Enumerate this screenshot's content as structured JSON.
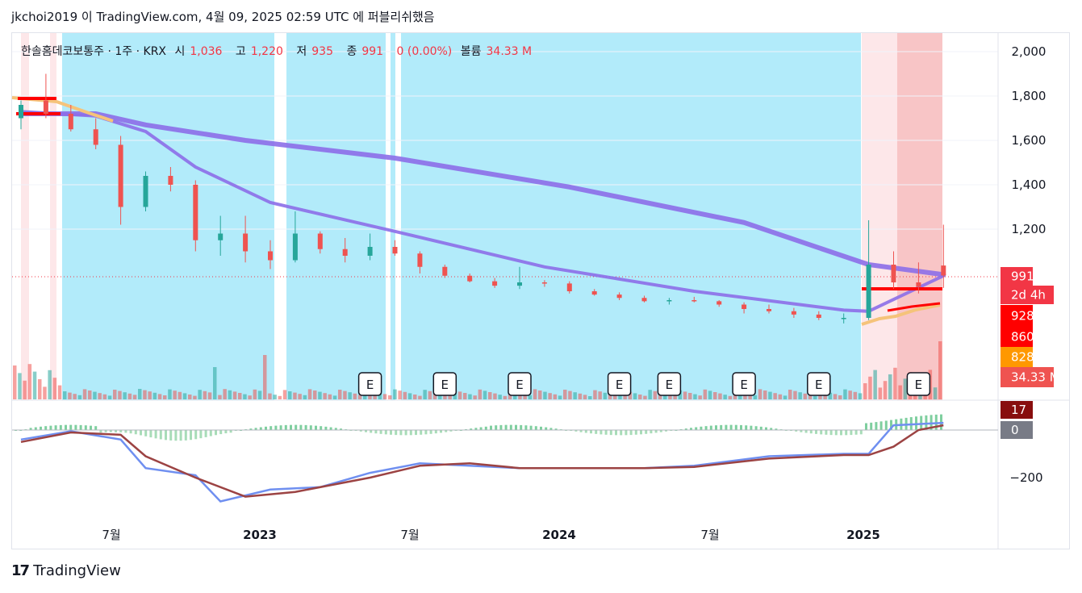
{
  "header": {
    "publish_line": "jkchoi2019 이 TradingView.com, 4월 09, 2025 02:59 UTC 에 퍼블리쉬했음"
  },
  "legend": {
    "symbol": "한솔홈데코보통주 · 1주 · KRX",
    "open_label": "시",
    "open": "1,036",
    "high_label": "고",
    "high": "1,220",
    "low_label": "저",
    "low": "935",
    "close_label": "종",
    "close": "991",
    "change": "0 (0.00%)",
    "volume_label": "볼륨",
    "volume": "34.33 M"
  },
  "price_axis": [
    "2,000",
    "1,800",
    "1,600",
    "1,400",
    "1,200"
  ],
  "macd_axis": [
    "−200"
  ],
  "time_axis": [
    "7월",
    "2023",
    "7월",
    "2024",
    "7월",
    "2025"
  ],
  "badges": [
    {
      "text": "991",
      "color": "#f23645"
    },
    {
      "text": "2d 4h",
      "color": "#f23645"
    },
    {
      "text": "928",
      "color": "#ff0000"
    },
    {
      "text": "860",
      "color": "#ff0000"
    },
    {
      "text": "828",
      "color": "#ff9800"
    },
    {
      "text": "34.33 M",
      "color": "#ef5350"
    },
    {
      "text": "17",
      "color": "#880e0e"
    },
    {
      "text": "0",
      "color": "#787b86"
    }
  ],
  "earnings_marker": "E",
  "footer": {
    "logo": "17",
    "brand": "TradingView"
  },
  "colors": {
    "up": "#26a69a",
    "down": "#ef5350",
    "ma_slow": "#8c6ee8",
    "ma_fast_sell": "#ff0000",
    "ma_fast_buy": "#f5c37a",
    "bg_blue": "#b2ebfa",
    "bg_pink": "#fde7e9",
    "bg_red": "#f8c5c6",
    "macd": "#6f8ff0",
    "signal": "#9c4343",
    "hist_pos": "#7fcf9f"
  },
  "chart_data": {
    "type": "candlestick",
    "interval": "1 week",
    "ylim": [
      800,
      2050
    ],
    "last_close": 991,
    "earnings_weeks": [
      "2023-05",
      "2023-08",
      "2023-11",
      "2024-03",
      "2024-05",
      "2024-08",
      "2024-11",
      "2025-03"
    ],
    "moving_averages": [
      {
        "points": [
          [
            "2022-03",
            1720
          ],
          [
            "2022-06",
            1720
          ],
          [
            "2022-08",
            1670
          ],
          [
            "2022-12",
            1600
          ],
          [
            "2023-06",
            1520
          ],
          [
            "2024-01",
            1390
          ],
          [
            "2024-08",
            1230
          ],
          [
            "2025-01",
            1040
          ],
          [
            "2025-04",
            995
          ]
        ]
      },
      {
        "points": [
          [
            "2022-03",
            1730
          ],
          [
            "2022-06",
            1710
          ],
          [
            "2022-08",
            1640
          ],
          [
            "2022-10",
            1480
          ],
          [
            "2023-01",
            1320
          ],
          [
            "2023-06",
            1190
          ],
          [
            "2023-12",
            1030
          ],
          [
            "2024-06",
            920
          ],
          [
            "2024-12",
            835
          ],
          [
            "2025-01",
            830
          ],
          [
            "2025-04",
            990
          ]
        ]
      }
    ],
    "macd": {
      "ylim": [
        -330,
        80
      ],
      "macd_line": [
        [
          "2022-03",
          -40
        ],
        [
          "2022-05",
          -5
        ],
        [
          "2022-07",
          -40
        ],
        [
          "2022-08",
          -160
        ],
        [
          "2022-10",
          -190
        ],
        [
          "2022-11",
          -300
        ],
        [
          "2023-01",
          -250
        ],
        [
          "2023-03",
          -240
        ],
        [
          "2023-05",
          -180
        ],
        [
          "2023-07",
          -140
        ],
        [
          "2023-09",
          -150
        ],
        [
          "2023-11",
          -160
        ],
        [
          "2024-01",
          -160
        ],
        [
          "2024-04",
          -160
        ],
        [
          "2024-06",
          -150
        ],
        [
          "2024-09",
          -110
        ],
        [
          "2024-12",
          -100
        ],
        [
          "2025-01",
          -100
        ],
        [
          "2025-02",
          20
        ],
        [
          "2025-04",
          30
        ]
      ],
      "signal_line": [
        [
          "2022-03",
          -50
        ],
        [
          "2022-05",
          -10
        ],
        [
          "2022-07",
          -20
        ],
        [
          "2022-08",
          -110
        ],
        [
          "2022-10",
          -200
        ],
        [
          "2022-12",
          -280
        ],
        [
          "2023-02",
          -260
        ],
        [
          "2023-05",
          -200
        ],
        [
          "2023-07",
          -150
        ],
        [
          "2023-09",
          -140
        ],
        [
          "2023-11",
          -160
        ],
        [
          "2024-01",
          -160
        ],
        [
          "2024-04",
          -160
        ],
        [
          "2024-06",
          -155
        ],
        [
          "2024-09",
          -120
        ],
        [
          "2024-12",
          -105
        ],
        [
          "2025-01",
          -105
        ],
        [
          "2025-02",
          -70
        ],
        [
          "2025-03",
          0
        ],
        [
          "2025-04",
          20
        ]
      ]
    },
    "ohlc": [
      [
        "2022-03",
        1700,
        1780,
        1650,
        1760
      ],
      [
        "2022-04",
        1780,
        1900,
        1700,
        1720
      ],
      [
        "2022-05",
        1720,
        1760,
        1640,
        1650
      ],
      [
        "2022-06",
        1650,
        1700,
        1560,
        1580
      ],
      [
        "2022-07",
        1580,
        1620,
        1220,
        1300
      ],
      [
        "2022-08",
        1300,
        1460,
        1280,
        1440
      ],
      [
        "2022-09",
        1440,
        1480,
        1370,
        1400
      ],
      [
        "2022-10",
        1400,
        1420,
        1100,
        1150
      ],
      [
        "2022-11",
        1150,
        1260,
        1080,
        1180
      ],
      [
        "2022-12",
        1180,
        1260,
        1050,
        1100
      ],
      [
        "2023-01",
        1100,
        1150,
        1020,
        1060
      ],
      [
        "2023-02",
        1060,
        1280,
        1050,
        1180
      ],
      [
        "2023-03",
        1180,
        1190,
        1090,
        1110
      ],
      [
        "2023-04",
        1110,
        1160,
        1050,
        1080
      ],
      [
        "2023-05",
        1080,
        1180,
        1060,
        1120
      ],
      [
        "2023-06",
        1120,
        1150,
        1080,
        1090
      ],
      [
        "2023-07",
        1090,
        1100,
        1000,
        1030
      ],
      [
        "2023-08",
        1030,
        1040,
        980,
        990
      ],
      [
        "2023-09",
        990,
        1000,
        960,
        965
      ],
      [
        "2023-10",
        965,
        980,
        935,
        945
      ],
      [
        "2023-11",
        945,
        1030,
        930,
        960
      ],
      [
        "2023-12",
        960,
        970,
        940,
        955
      ],
      [
        "2024-01",
        955,
        965,
        910,
        920
      ],
      [
        "2024-02",
        920,
        930,
        900,
        905
      ],
      [
        "2024-03",
        905,
        915,
        880,
        890
      ],
      [
        "2024-04",
        890,
        900,
        870,
        875
      ],
      [
        "2024-05",
        875,
        890,
        860,
        880
      ],
      [
        "2024-06",
        880,
        895,
        870,
        875
      ],
      [
        "2024-07",
        875,
        880,
        850,
        860
      ],
      [
        "2024-08",
        860,
        870,
        820,
        840
      ],
      [
        "2024-09",
        840,
        860,
        820,
        830
      ],
      [
        "2024-10",
        830,
        845,
        800,
        815
      ],
      [
        "2024-11",
        815,
        830,
        790,
        800
      ],
      [
        "2024-12",
        800,
        820,
        775,
        800
      ],
      [
        "2025-01",
        800,
        1240,
        790,
        1040
      ],
      [
        "2025-02",
        1040,
        1100,
        930,
        960
      ],
      [
        "2025-03",
        960,
        1050,
        910,
        940
      ],
      [
        "2025-04",
        1036,
        1220,
        935,
        991
      ]
    ]
  }
}
